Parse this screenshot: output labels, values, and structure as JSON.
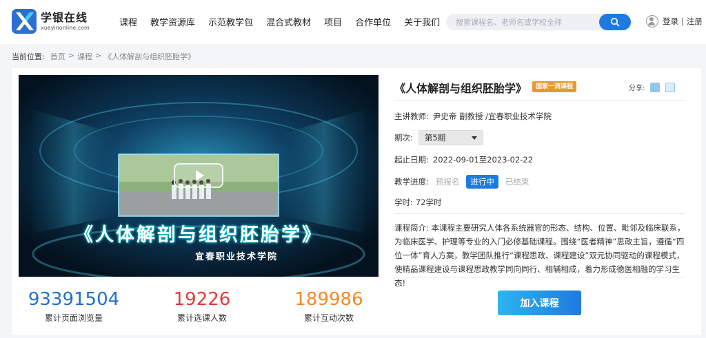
{
  "logo": {
    "name_cn": "学银在线",
    "name_en": "xueyinonline.com",
    "brand_color": "#2d6fd0"
  },
  "nav": {
    "items": [
      "课程",
      "教学资源库",
      "示范教学包",
      "混合式教材",
      "项目",
      "合作单位",
      "关于我们"
    ]
  },
  "search": {
    "placeholder": "搜索课程名、老师名或学校全称",
    "button_icon": "search-icon"
  },
  "user": {
    "login": "登录",
    "separator": "|",
    "register": "注册"
  },
  "breadcrumb": {
    "label": "当前位置:",
    "home": "首页",
    "courses": "课程",
    "current": "《人体解剖与组织胚胎学》",
    "arrow": ">"
  },
  "video": {
    "title": "《人体解剖与组织胚胎学》",
    "school": "宜春职业技术学院"
  },
  "stats": [
    {
      "value": "93391504",
      "label": "累计页面浏览量",
      "color": "#1f6fc8"
    },
    {
      "value": "19226",
      "label": "累计选课人数",
      "color": "#e03b3b"
    },
    {
      "value": "189986",
      "label": "累计互动次数",
      "color": "#f08a24"
    }
  ],
  "course": {
    "title": "《人体解剖与组织胚胎学》",
    "badge": "国家一流课程",
    "share_label": "分享:",
    "teacher_label": "主讲教师:",
    "teacher": "尹史帝 副教授 /宜春职业技术学院",
    "term_label": "期次:",
    "term_value": "第5期",
    "date_label": "起止日期:",
    "date_value": "2022-09-01至2023-02-22",
    "progress_label": "教学进度:",
    "progress_states": [
      "预报名",
      "进行中",
      "已结束"
    ],
    "hours_label": "学时:",
    "hours_value": "72学时",
    "intro_label": "课程简介:",
    "intro": "本课程主要研究人体各系统器官的形态、结构、位置、毗邻及临床联系，为临床医学、护理等专业的入门必修基础课程。围绕“医者精神”思政主旨，遵循“四位一体”育人方案，教学团队推行“课程思政、课程建设”双元协同驱动的课程模式，使精品课程建设与课程思政教学同向同行、相辅相成，着力形成德医相融的学习生态!",
    "join_label": "加入课程"
  }
}
